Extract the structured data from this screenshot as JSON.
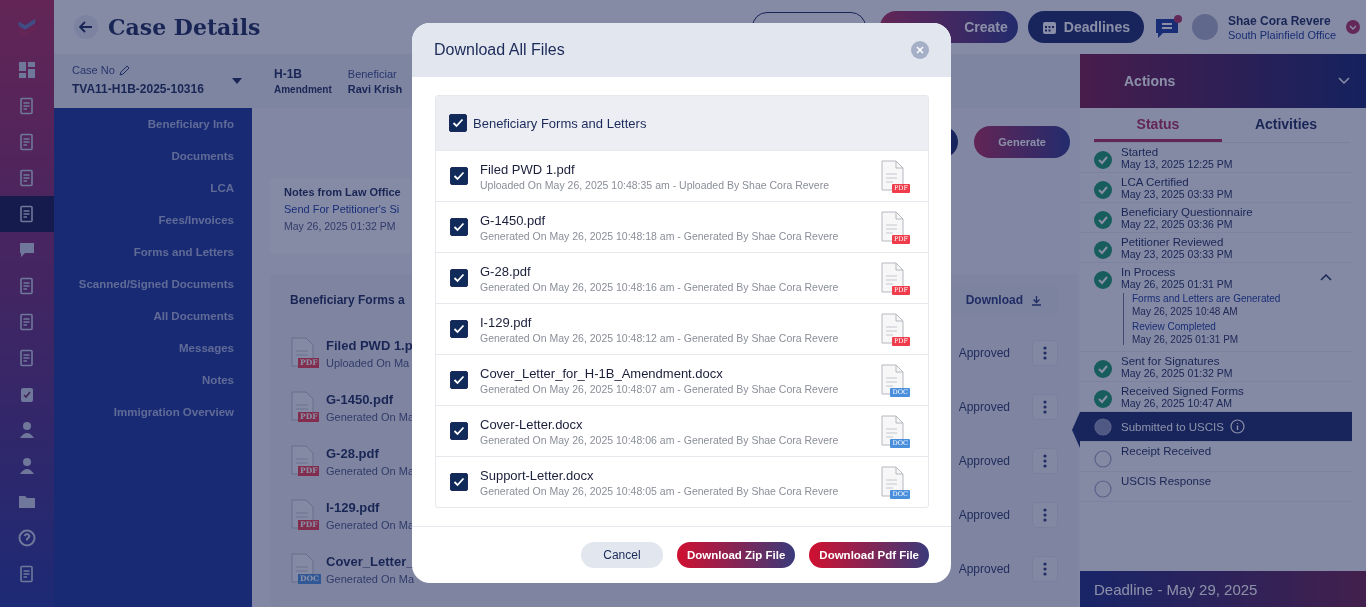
{
  "rail": [
    {
      "selected": false
    },
    {
      "selected": false
    },
    {
      "selected": false
    },
    {
      "selected": false
    },
    {
      "selected": true
    },
    {
      "selected": false
    },
    {
      "selected": false
    },
    {
      "selected": false
    },
    {
      "selected": false
    },
    {
      "selected": false
    },
    {
      "selected": false
    },
    {
      "selected": false
    },
    {
      "selected": false
    },
    {
      "selected": false
    },
    {
      "selected": false
    }
  ],
  "header": {
    "title": "Case Details",
    "create": "Create",
    "deadlines": "Deadlines",
    "user_name": "Shae Cora Revere",
    "user_office": "South Plainfield Office"
  },
  "case_bar": {
    "case_no_label": "Case No",
    "case_no": "TVA11-H1B-2025-10316",
    "visa": "H-1B",
    "visa_type": "Amendment",
    "beneficiary_label": "Beneficiar",
    "beneficiary": "Ravi Krish"
  },
  "sidebar": {
    "items": [
      "Beneficiary Info",
      "Documents",
      "LCA",
      "Fees/Invoices",
      "Forms and Letters",
      "Scanned/Signed Documents",
      "All Documents",
      "Messages",
      "Notes",
      "Immigration Overview"
    ]
  },
  "content": {
    "generate": "Generate",
    "notes_title": "Notes from Law Office",
    "note": "Send For Petitioner's Si",
    "note_time": "May 26, 2025 01:32 PM",
    "section_title": "Beneficiary Forms a",
    "download": "Download",
    "files": [
      {
        "name": "Filed PWD 1.p",
        "meta": "Uploaded On Ma",
        "badge": "PDF",
        "kind": "pdf",
        "status": "Approved"
      },
      {
        "name": "G-1450.pdf",
        "meta": "Generated On Ma",
        "badge": "PDF",
        "kind": "pdf",
        "status": "Approved"
      },
      {
        "name": "G-28.pdf",
        "meta": "Generated On Ma",
        "badge": "PDF",
        "kind": "pdf",
        "status": "Approved"
      },
      {
        "name": "I-129.pdf",
        "meta": "Generated On Ma",
        "badge": "PDF",
        "kind": "pdf",
        "status": "Approved"
      },
      {
        "name": "Cover_Letter_",
        "meta": "Generated On Ma",
        "badge": "DOC",
        "kind": "doc",
        "status": "Approved"
      }
    ]
  },
  "actions": {
    "title": "Actions",
    "tabs": [
      {
        "label": "Status",
        "selected": true
      },
      {
        "label": "Activities",
        "selected": false
      }
    ],
    "steps": [
      {
        "title": "Started",
        "time": "May 13, 2025 12:25 PM",
        "done": true,
        "selected": false
      },
      {
        "title": "LCA Certified",
        "time": "May 23, 2025 03:33 PM",
        "done": true,
        "selected": false
      },
      {
        "title": "Beneficiary Questionnaire",
        "time": "May 22, 2025 03:36 PM",
        "done": true,
        "selected": false
      },
      {
        "title": "Petitioner Reviewed",
        "time": "May 23, 2025 03:33 PM",
        "done": true,
        "selected": false
      },
      {
        "title": "In Process",
        "time": "May 26, 2025 01:31 PM",
        "done": true,
        "selected": false,
        "expanded": true,
        "children": [
          {
            "title": "Forms and Letters are Generated",
            "time": "May 26, 2025 10:48 AM"
          },
          {
            "title": "Review Completed",
            "time": "May 26, 2025 01:31 PM"
          }
        ]
      },
      {
        "title": "Sent for Signatures",
        "time": "May 26, 2025 01:32 PM",
        "done": true,
        "selected": false
      },
      {
        "title": "Received Signed Forms",
        "time": "May 26, 2025 10:47 AM",
        "done": true,
        "selected": false
      },
      {
        "title": "Submitted to USCIS",
        "done": false,
        "selected": true
      },
      {
        "title": "Receipt Received",
        "done": false,
        "selected": false
      },
      {
        "title": "USCIS Response",
        "done": false,
        "selected": false
      }
    ],
    "deadline": "Deadline - May 29, 2025"
  },
  "modal": {
    "title": "Download All Files",
    "group": {
      "label": "Beneficiary Forms and Letters",
      "checked": true
    },
    "files": [
      {
        "name": "Filed PWD 1.pdf",
        "meta": "Uploaded On May 26, 2025 10:48:35 am - Uploaded By Shae Cora Revere",
        "checked": true,
        "badge": "PDF",
        "kind": "pdf"
      },
      {
        "name": "G-1450.pdf",
        "meta": "Generated On May 26, 2025 10:48:18 am - Generated By Shae Cora Revere",
        "checked": true,
        "badge": "PDF",
        "kind": "pdf"
      },
      {
        "name": "G-28.pdf",
        "meta": "Generated On May 26, 2025 10:48:16 am - Generated By Shae Cora Revere",
        "checked": true,
        "badge": "PDF",
        "kind": "pdf"
      },
      {
        "name": "I-129.pdf",
        "meta": "Generated On May 26, 2025 10:48:12 am - Generated By Shae Cora Revere",
        "checked": true,
        "badge": "PDF",
        "kind": "pdf"
      },
      {
        "name": "Cover_Letter_for_H-1B_Amendment.docx",
        "meta": "Generated On May 26, 2025 10:48:07 am - Generated By Shae Cora Revere",
        "checked": true,
        "badge": "DOC",
        "kind": "doc"
      },
      {
        "name": "Cover-Letter.docx",
        "meta": "Generated On May 26, 2025 10:48:06 am - Generated By Shae Cora Revere",
        "checked": true,
        "badge": "DOC",
        "kind": "doc"
      },
      {
        "name": "Support-Letter.docx",
        "meta": "Generated On May 26, 2025 10:48:05 am - Generated By Shae Cora Revere",
        "checked": true,
        "badge": "DOC",
        "kind": "doc"
      }
    ],
    "cancel": "Cancel",
    "zip": "Download Zip File",
    "pdf": "Download Pdf File"
  }
}
